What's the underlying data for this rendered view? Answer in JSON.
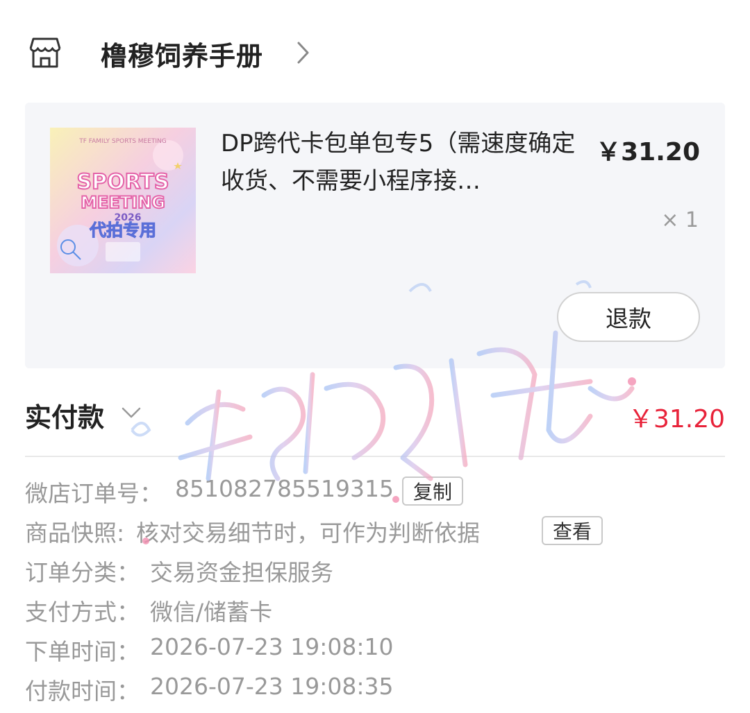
{
  "shop": {
    "name": "橹穆饲养手册",
    "icon": "store-icon"
  },
  "product": {
    "title": "DP跨代卡包单包专5（需速度确定收货、不需要小程序接…",
    "price": "￥31.20",
    "quantity": "× 1",
    "refund_label": "退款",
    "thumbnail": {
      "top_text": "TF FAMILY SPORTS MEETING",
      "line1": "SPORTS",
      "line2": "MEETING",
      "year": "2026",
      "tag": "代拍专用"
    }
  },
  "payment": {
    "paid_label": "实付款",
    "paid_amount": "￥31.20"
  },
  "details": {
    "order_no_label": "微店订单号：",
    "order_no_value": "851082785519315",
    "copy_label": "复制",
    "snapshot_label": "商品快照:",
    "snapshot_value": "核对交易细节时，可作为判断依据",
    "view_label": "查看",
    "category_label": "订单分类：",
    "category_value": "交易资金担保服务",
    "pay_method_label": "支付方式：",
    "pay_method_value": "微信/储蓄卡",
    "order_time_label": "下单时间：",
    "order_time_value": "2026-07-23 19:08:10",
    "pay_time_label": "付款时间：",
    "pay_time_value": "2026-07-23 19:08:35"
  },
  "colors": {
    "accent_red": "#e8233a",
    "card_bg": "#f5f6f9",
    "muted_text": "#999999"
  }
}
